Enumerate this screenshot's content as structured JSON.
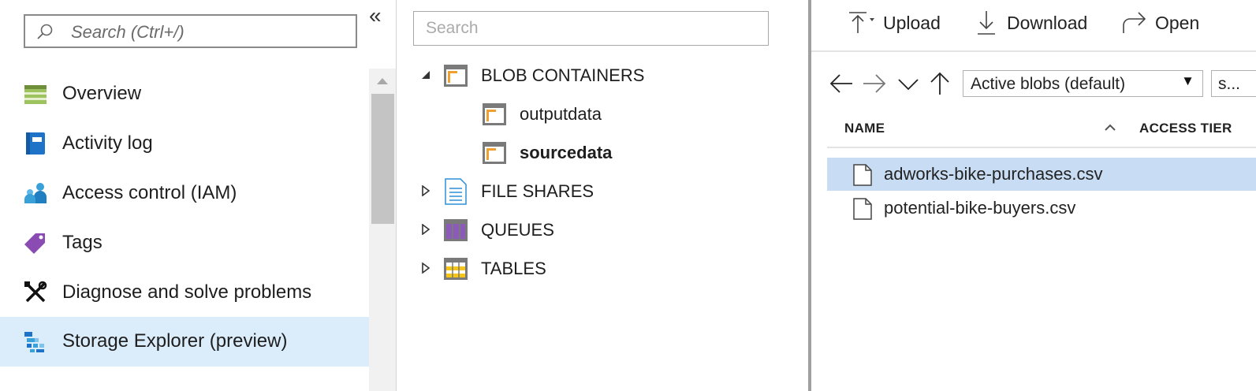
{
  "left_nav": {
    "search_placeholder": "Search (Ctrl+/)",
    "collapse_glyph": "«",
    "items": [
      {
        "label": "Overview",
        "icon": "overview-icon"
      },
      {
        "label": "Activity log",
        "icon": "activity-log-icon"
      },
      {
        "label": "Access control (IAM)",
        "icon": "access-control-icon"
      },
      {
        "label": "Tags",
        "icon": "tag-icon"
      },
      {
        "label": "Diagnose and solve problems",
        "icon": "wrench-icon"
      },
      {
        "label": "Storage Explorer (preview)",
        "icon": "storage-explorer-icon",
        "active": true
      }
    ]
  },
  "tree": {
    "search_placeholder": "Search",
    "nodes": [
      {
        "label": "BLOB CONTAINERS",
        "icon": "blob-container-icon",
        "expanded": true
      },
      {
        "label": "outputdata",
        "icon": "container-icon"
      },
      {
        "label": "sourcedata",
        "icon": "container-icon",
        "selected": true
      },
      {
        "label": "FILE SHARES",
        "icon": "file-share-icon",
        "expanded": false
      },
      {
        "label": "QUEUES",
        "icon": "queue-icon",
        "expanded": false
      },
      {
        "label": "TABLES",
        "icon": "table-icon",
        "expanded": false
      }
    ]
  },
  "toolbar": {
    "upload_label": "Upload",
    "download_label": "Download",
    "open_label": "Open"
  },
  "filter": {
    "view_selected": "Active blobs (default)",
    "second_value": "s..."
  },
  "file_list": {
    "columns": [
      "NAME",
      "ACCESS TIER"
    ],
    "rows": [
      {
        "name": "adworks-bike-purchases.csv",
        "selected": true
      },
      {
        "name": "potential-bike-buyers.csv",
        "selected": false
      }
    ]
  },
  "colors": {
    "active_nav": "#dbecfb",
    "selected_row": "#c8ddf4",
    "accent_blue": "#0078d4"
  }
}
